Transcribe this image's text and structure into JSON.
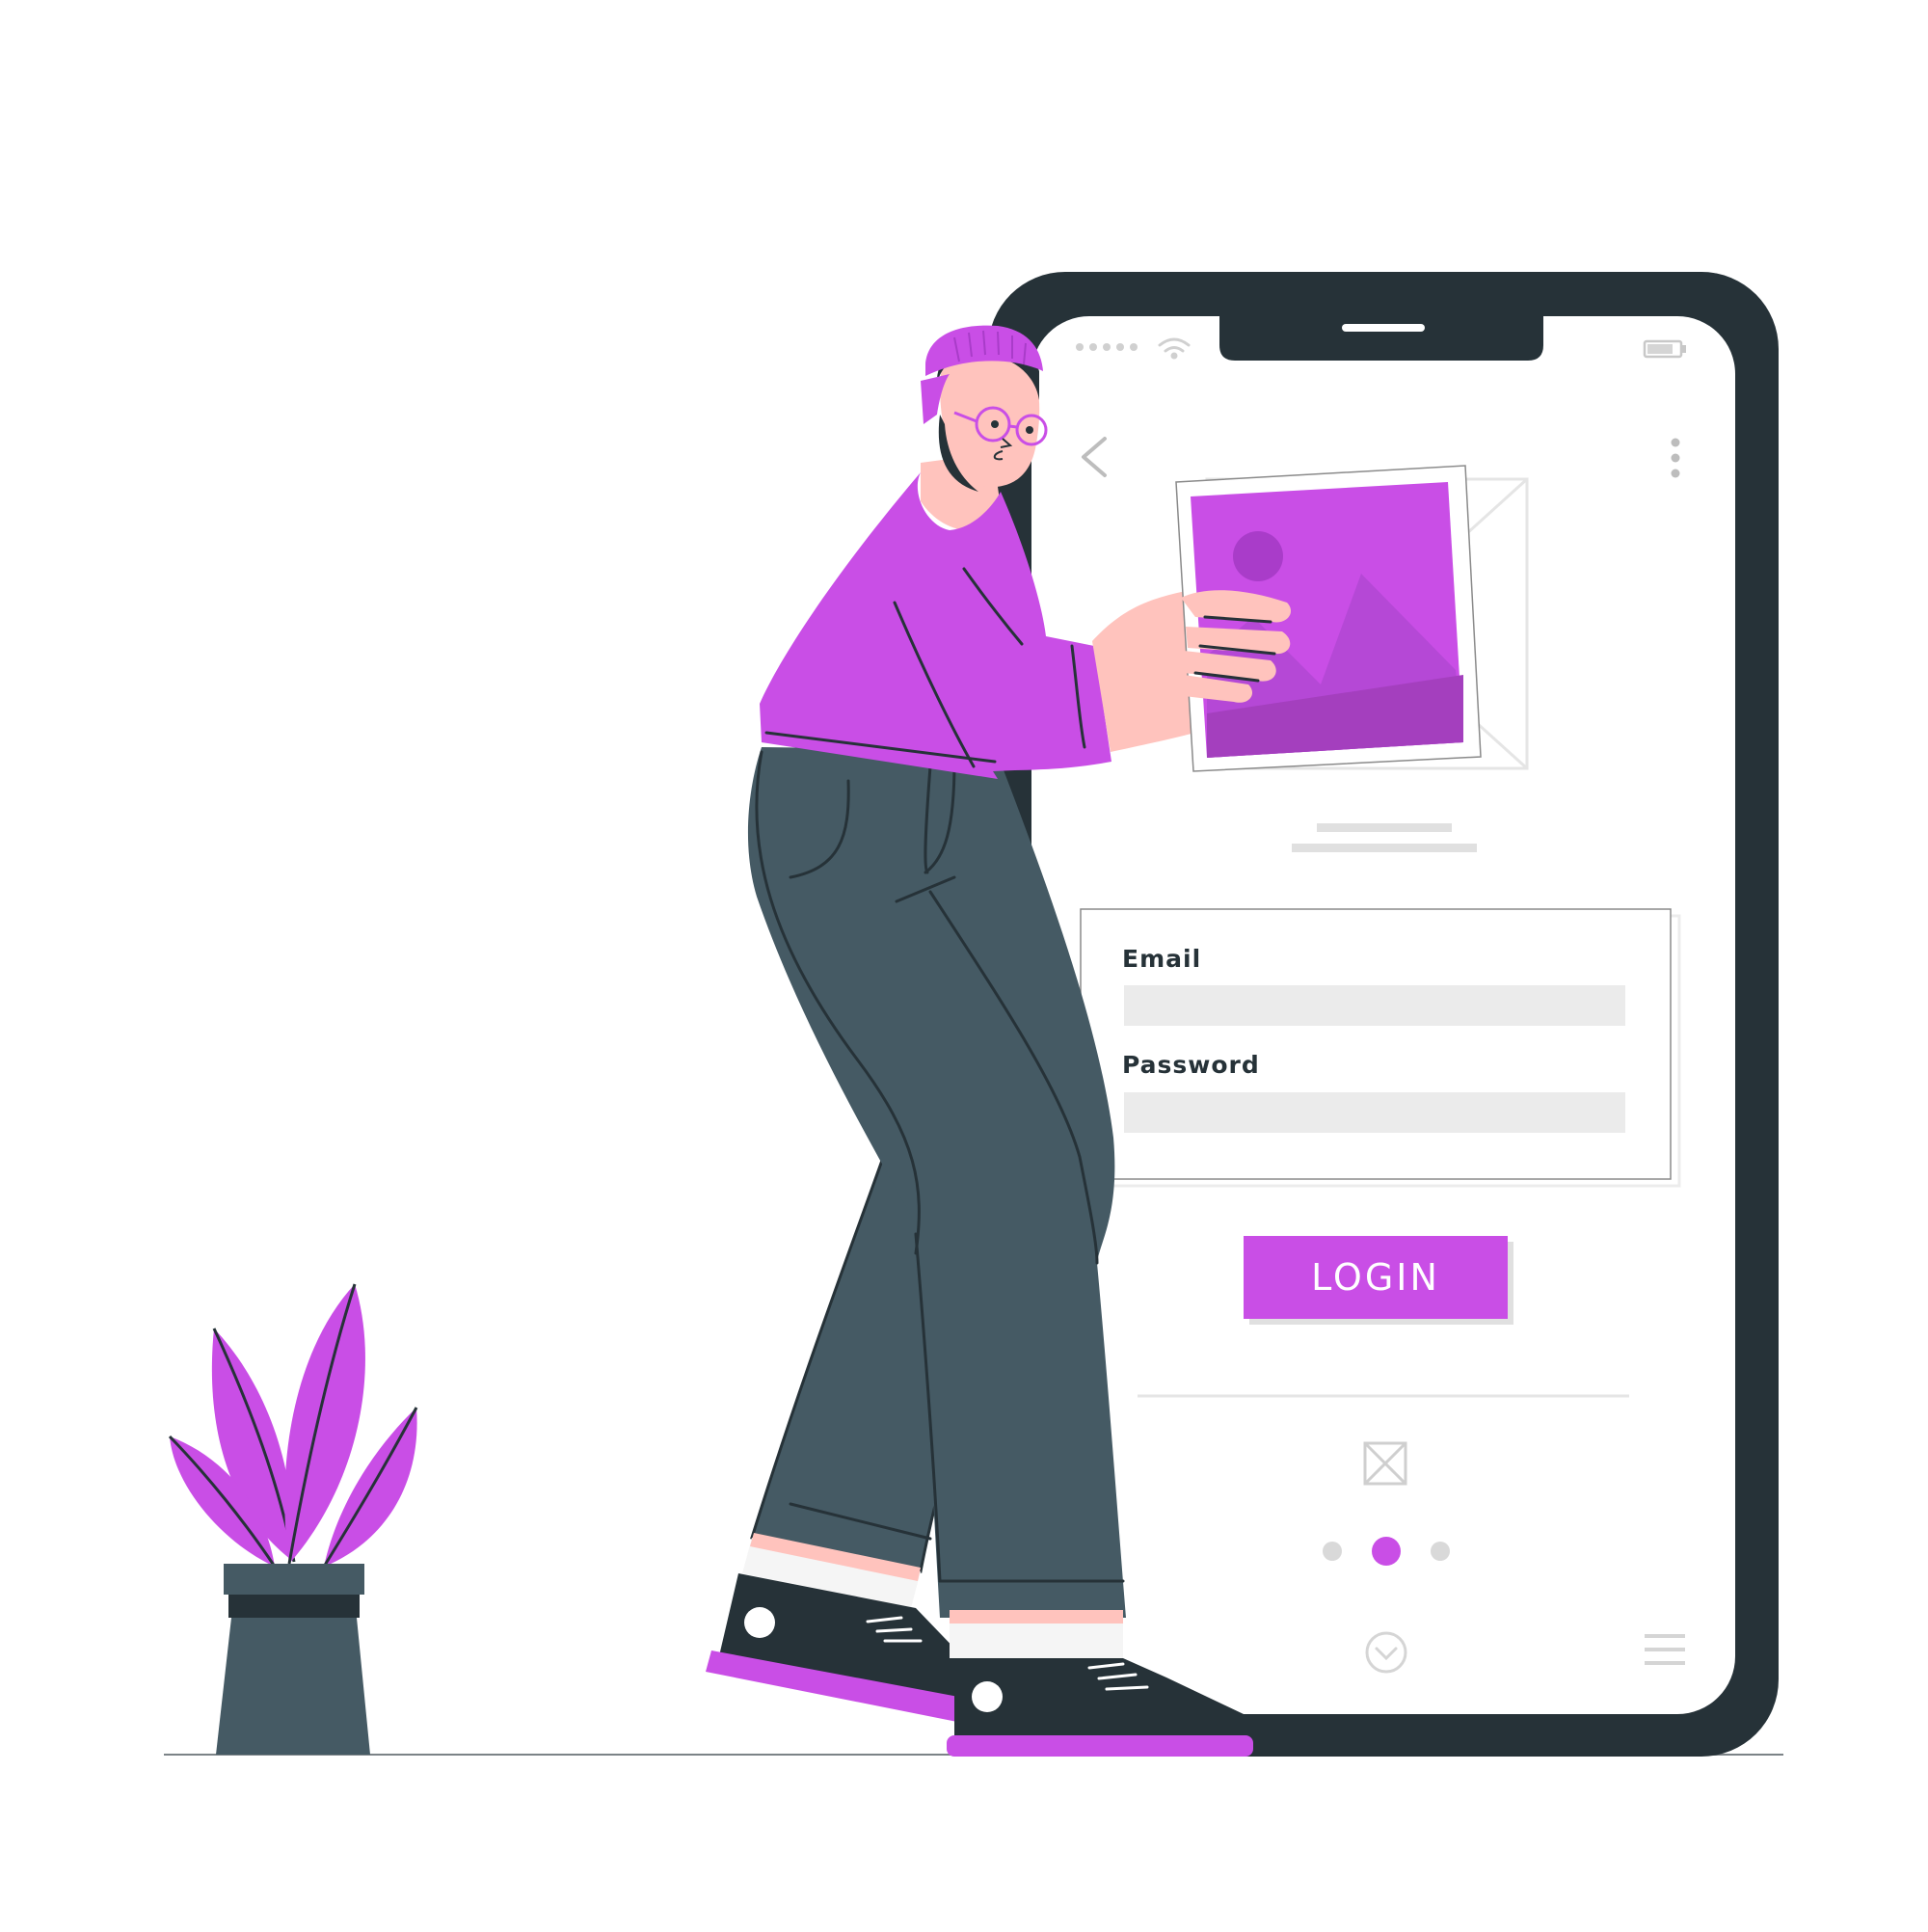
{
  "login_form": {
    "email_label": "Email",
    "password_label": "Password",
    "email_value": "",
    "password_value": "",
    "login_button": "LOGIN"
  },
  "pagination": {
    "total": 3,
    "active_index": 1
  },
  "icons": {
    "back": "chevron-left-icon",
    "more": "more-vertical-icon",
    "wifi": "wifi-icon",
    "battery": "battery-icon",
    "broken_image": "broken-image-icon",
    "down": "chevron-down-circle-icon",
    "menu": "hamburger-menu-icon"
  },
  "colors": {
    "accent": "#c94ee6",
    "dark": "#263238",
    "pants": "#455a64",
    "skin": "#ffc3bd",
    "field": "#ebebeb",
    "muted": "#e0e0e0"
  }
}
